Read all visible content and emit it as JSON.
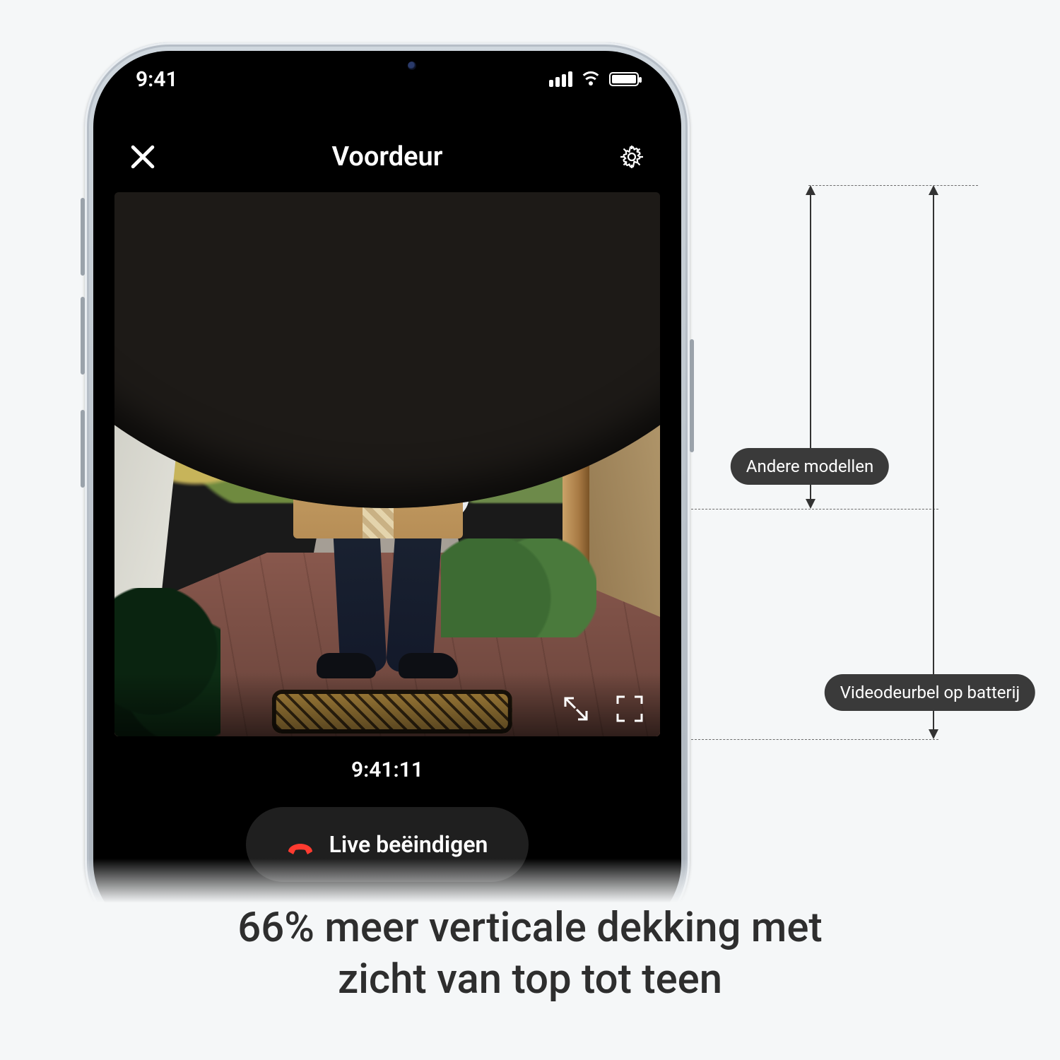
{
  "statusbar": {
    "time": "9:41"
  },
  "header": {
    "title": "Voordeur"
  },
  "feed": {
    "timestamp": "9:41:11"
  },
  "controls": {
    "end_live_label": "Live beëindigen"
  },
  "comparison": {
    "other_models_label": "Andere modellen",
    "battery_doorbell_label": "Videodeurbel op batterij"
  },
  "caption": {
    "line1": "66% meer verticale dekking met",
    "line2": "zicht van top tot teen"
  }
}
